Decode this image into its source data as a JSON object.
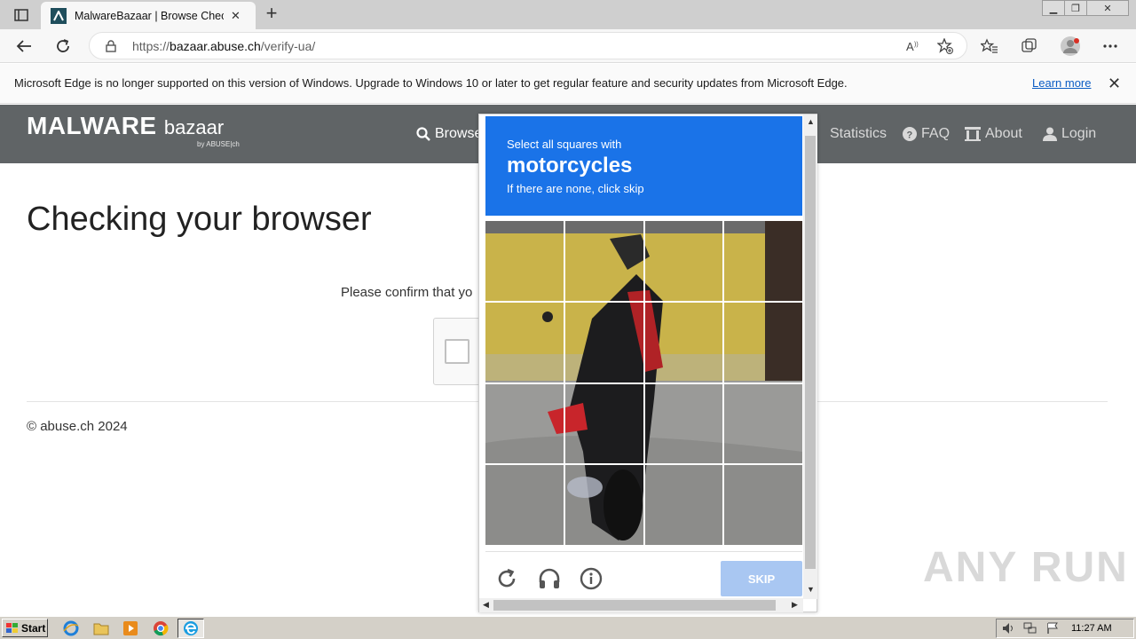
{
  "browser": {
    "tab_title": "MalwareBazaar | Browse Checkin",
    "url_prefix": "https://",
    "url_domain": "bazaar.abuse.ch",
    "url_path": "/verify-ua/"
  },
  "infobar": {
    "message": "Microsoft Edge is no longer supported on this version of Windows. Upgrade to Windows 10 or later to get regular feature and security updates from Microsoft Edge.",
    "link": "Learn more"
  },
  "site": {
    "logo_malware": "MALWARE",
    "logo_bazaar": "bazaar",
    "logo_sub": "by ABUSE|ch",
    "nav": {
      "browse": "Browse",
      "statistics": "Statistics",
      "faq": "FAQ",
      "about": "About",
      "login": "Login"
    }
  },
  "page": {
    "heading": "Checking your browser",
    "confirm": "Please confirm that yo",
    "footer": "© abuse.ch 2024"
  },
  "challenge": {
    "line1": "Select all squares with",
    "target": "motorcycles",
    "line3": "If there are none, click skip",
    "skip": "SKIP",
    "accent": "#1a73e8"
  },
  "watermark": "ANY RUN",
  "taskbar": {
    "start": "Start",
    "clock": "11:27 AM"
  }
}
